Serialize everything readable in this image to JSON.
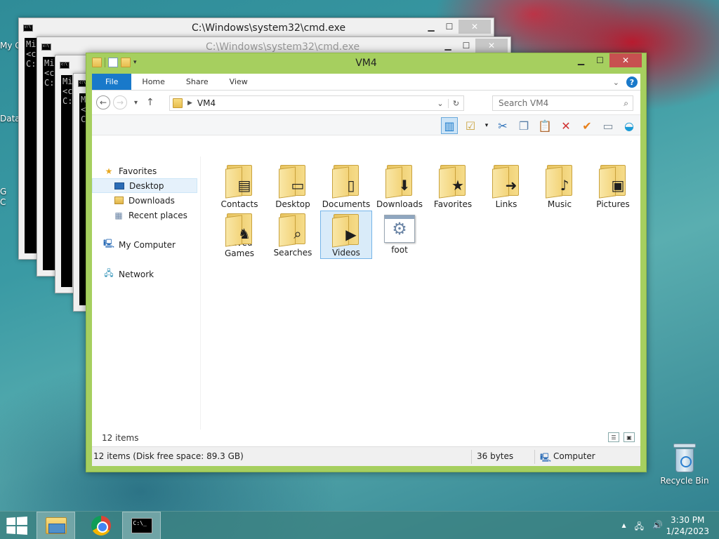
{
  "desktop": {
    "recycle_bin_label": "Recycle Bin",
    "left_stubs": [
      "My C",
      "Data",
      "G",
      "C"
    ]
  },
  "cmd_windows": [
    {
      "title": "C:\\Windows\\system32\\cmd.exe",
      "lines": [
        "Mi",
        "<c",
        "",
        "C:"
      ]
    },
    {
      "title": "C:\\Windows\\system32\\cmd.exe",
      "lines": [
        "Mi",
        "<c",
        "",
        "C:"
      ]
    },
    {
      "title": "",
      "lines": [
        "Mi",
        "<c",
        "",
        "C:"
      ]
    },
    {
      "title": "",
      "lines": [
        "Mi",
        "<c",
        "",
        "C:"
      ]
    }
  ],
  "explorer": {
    "title": "VM4",
    "ribbon_tabs": [
      "File",
      "Home",
      "Share",
      "View"
    ],
    "address": {
      "path": "VM4"
    },
    "search_placeholder": "Search VM4",
    "nav_pane": {
      "favorites": "Favorites",
      "favorites_items": [
        "Desktop",
        "Downloads",
        "Recent places"
      ],
      "my_computer": "My Computer",
      "network": "Network"
    },
    "files": [
      {
        "label": "Contacts",
        "icon": "contacts-folder-icon",
        "overlay": "▤"
      },
      {
        "label": "Desktop",
        "icon": "desktop-folder-icon",
        "overlay": "▭"
      },
      {
        "label": "Documents",
        "icon": "documents-folder-icon",
        "overlay": "▯"
      },
      {
        "label": "Downloads",
        "icon": "downloads-folder-icon",
        "overlay": "⬇"
      },
      {
        "label": "Favorites",
        "icon": "favorites-folder-icon",
        "overlay": "★"
      },
      {
        "label": "Links",
        "icon": "links-folder-icon",
        "overlay": "➜"
      },
      {
        "label": "Music",
        "icon": "music-folder-icon",
        "overlay": "♪"
      },
      {
        "label": "Pictures",
        "icon": "pictures-folder-icon",
        "overlay": "▣"
      },
      {
        "label": "Saved Games",
        "icon": "saved-games-folder-icon",
        "overlay": "♞"
      },
      {
        "label": "Searches",
        "icon": "searches-folder-icon",
        "overlay": "⌕"
      },
      {
        "label": "Videos",
        "icon": "videos-folder-icon",
        "overlay": "▶"
      },
      {
        "label": "foot",
        "icon": "gear-file-icon",
        "overlay": "⚙"
      }
    ],
    "status_count": "12 items",
    "details": {
      "left": "12 items (Disk free space: 89.3 GB)",
      "size": "36 bytes",
      "location": "Computer"
    }
  },
  "taskbar": {
    "clock_time": "3:30 PM",
    "clock_date": "1/24/2023",
    "tray_icons": [
      "show-hidden-icons-icon",
      "network-icon",
      "volume-icon"
    ],
    "tray_glyphs": [
      "▲",
      "🖧",
      "🔊"
    ]
  },
  "colors": {
    "explorer_frame": "#a6cf5f",
    "file_tab": "#1979ca",
    "close_button": "#c75050",
    "selection": "#d9ebf9"
  }
}
